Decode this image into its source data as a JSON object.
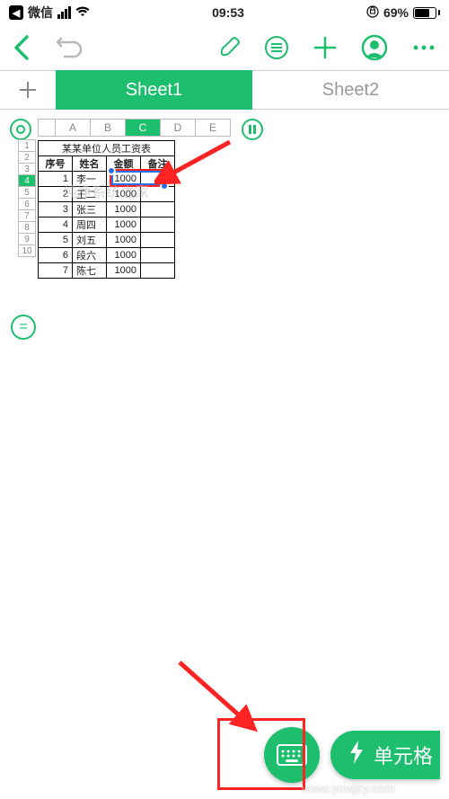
{
  "status": {
    "carrier": "微信",
    "time": "09:53",
    "battery_pct": "69%"
  },
  "toolbar": {
    "back_icon": "back",
    "undo_icon": "undo",
    "brush_icon": "brush",
    "list_icon": "list",
    "add_icon": "add",
    "profile_icon": "profile",
    "more_icon": "more"
  },
  "tabs": {
    "add": "+",
    "items": [
      {
        "label": "Sheet1",
        "active": true
      },
      {
        "label": "Sheet2",
        "active": false
      }
    ]
  },
  "columns": [
    "A",
    "B",
    "C",
    "D",
    "E"
  ],
  "column_selected": "C",
  "rows": [
    "1",
    "2",
    "3",
    "4",
    "5",
    "6",
    "7",
    "8",
    "9",
    "10"
  ],
  "row_selected": "4",
  "table": {
    "title": "某某单位人员工资表",
    "headers": [
      "序号",
      "姓名",
      "金额",
      "备注"
    ],
    "rows": [
      {
        "seq": "1",
        "name": "李一",
        "amt": "1000",
        "note": ""
      },
      {
        "seq": "2",
        "name": "王二",
        "amt": "1000",
        "note": ""
      },
      {
        "seq": "3",
        "name": "张三",
        "amt": "1000",
        "note": ""
      },
      {
        "seq": "4",
        "name": "周四",
        "amt": "1000",
        "note": ""
      },
      {
        "seq": "5",
        "name": "刘五",
        "amt": "1000",
        "note": ""
      },
      {
        "seq": "6",
        "name": "段六",
        "amt": "1000",
        "note": ""
      },
      {
        "seq": "7",
        "name": "陈七",
        "amt": "1000",
        "note": ""
      }
    ]
  },
  "side_buttons": {
    "record": "O",
    "pause": "II",
    "equals": "="
  },
  "bottom": {
    "keyboard_icon": "keyboard",
    "cell_label": "单元格",
    "lightning": "⚡"
  },
  "watermark": "纯净系统之家",
  "watermark_url": "www.ycwjzy.com"
}
